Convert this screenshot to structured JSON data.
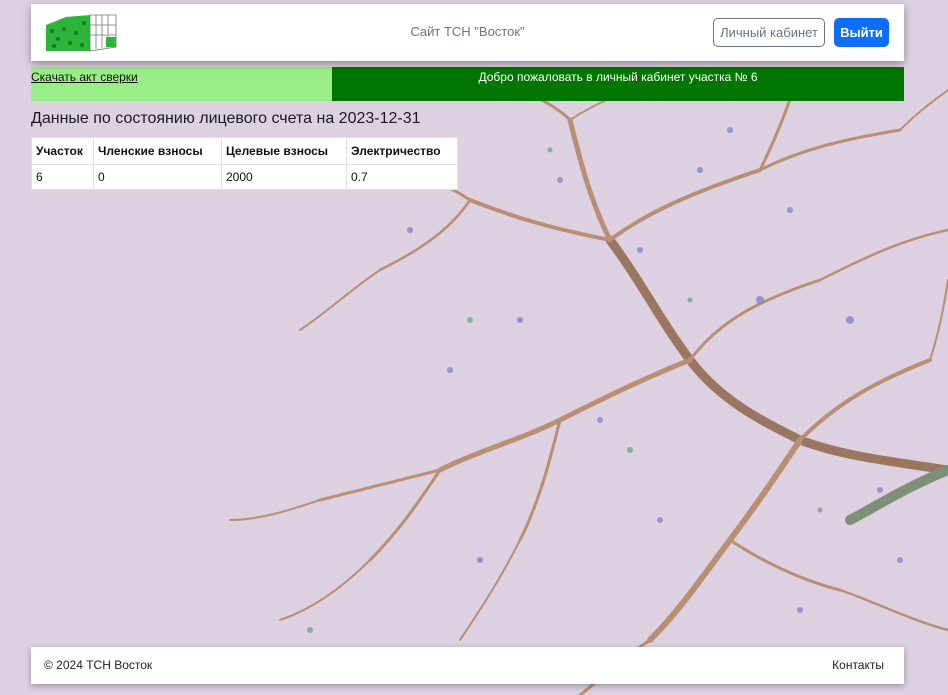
{
  "header": {
    "site_title": "Сайт ТСН \"Восток\"",
    "cabinet_button": "Личный кабинет",
    "exit_button": "Выйти"
  },
  "banner": {
    "download_link": "Скачать акт сверки",
    "welcome_text": "Добро пожаловать в личный кабинет участка № 6"
  },
  "account": {
    "heading": "Данные по состоянию лицевого счета на 2023-12-31",
    "columns": [
      "Участок",
      "Членские взносы",
      "Целевые взносы",
      "Электричество"
    ],
    "rows": [
      [
        "6",
        "0",
        "2000",
        "0.7"
      ]
    ]
  },
  "footer": {
    "copyright": "© 2024 ТСН Восток",
    "contacts_link": "Контакты"
  },
  "colors": {
    "welcome_bg": "#007500",
    "download_bg": "#99ee88",
    "primary_button": "#0d6efd",
    "page_bg": "#ddd0e0"
  }
}
